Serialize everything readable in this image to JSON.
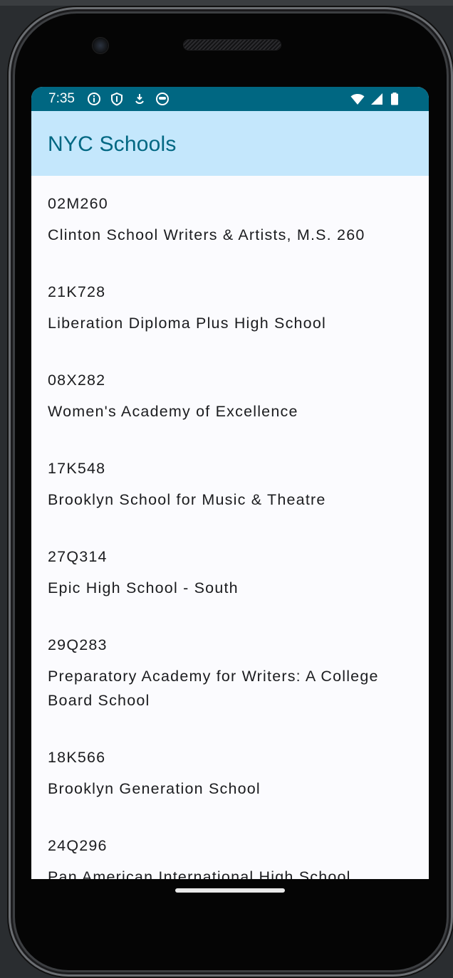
{
  "status_bar": {
    "time": "7:35",
    "left_icons": [
      "info-icon",
      "shield-icon",
      "download-icon",
      "face-icon"
    ],
    "right_icons": [
      "wifi-icon",
      "signal-icon",
      "battery-icon"
    ]
  },
  "app_bar": {
    "title": "NYC Schools"
  },
  "schools": [
    {
      "dbn": "02M260",
      "name": "Clinton School Writers & Artists, M.S. 260"
    },
    {
      "dbn": "21K728",
      "name": "Liberation Diploma Plus High School"
    },
    {
      "dbn": "08X282",
      "name": "Women's Academy of Excellence"
    },
    {
      "dbn": "17K548",
      "name": "Brooklyn School for Music & Theatre"
    },
    {
      "dbn": "27Q314",
      "name": "Epic High School - South"
    },
    {
      "dbn": "29Q283",
      "name": "Preparatory Academy for Writers: A College Board School"
    },
    {
      "dbn": "18K566",
      "name": "Brooklyn Generation School"
    },
    {
      "dbn": "24Q296",
      "name": "Pan American International High School"
    }
  ],
  "colors": {
    "status_bar": "#006782",
    "app_bar": "#c4e7fc",
    "title": "#006782",
    "background": "#fbfbfe",
    "text": "#1b1c1f"
  }
}
